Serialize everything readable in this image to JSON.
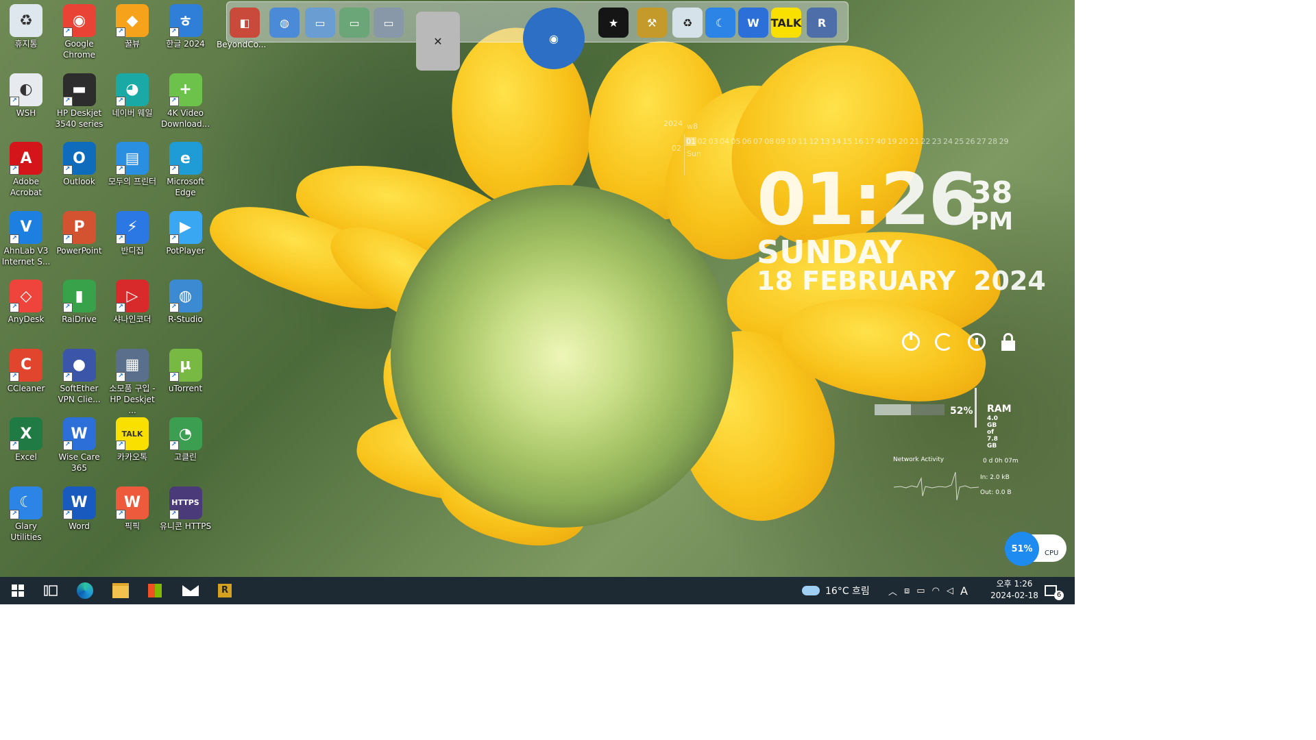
{
  "desktop": {
    "icons": [
      {
        "id": "recycle",
        "label": "휴지통",
        "color": "#dfe7ee",
        "glyph": "♻"
      },
      {
        "id": "chrome",
        "label": "Google Chrome",
        "color": "#e94335",
        "glyph": "◉"
      },
      {
        "id": "ggulbyu",
        "label": "꿀뷰",
        "color": "#f6a21a",
        "glyph": "◆"
      },
      {
        "id": "hangul",
        "label": "한글 2024",
        "color": "#2f7fd8",
        "glyph": "ㅎ"
      },
      {
        "id": "wsh",
        "label": "WSH",
        "color": "#e7eaee",
        "glyph": "◐"
      },
      {
        "id": "hp-deskjet",
        "label": "HP Deskjet 3540 series",
        "color": "#2d2d2d",
        "glyph": "▬"
      },
      {
        "id": "naver-whale",
        "label": "네이버 웨일",
        "color": "#1ba9a6",
        "glyph": "◕"
      },
      {
        "id": "4k-video",
        "label": "4K Video Download...",
        "color": "#6cc24a",
        "glyph": "+"
      },
      {
        "id": "acrobat",
        "label": "Adobe Acrobat",
        "color": "#d4161b",
        "glyph": "A"
      },
      {
        "id": "outlook",
        "label": "Outlook",
        "color": "#0f6cbd",
        "glyph": "O"
      },
      {
        "id": "modu-printer",
        "label": "모두의 프린터",
        "color": "#2a8fe0",
        "glyph": "▤"
      },
      {
        "id": "edge",
        "label": "Microsoft Edge",
        "color": "#1f9bd6",
        "glyph": "e"
      },
      {
        "id": "ahnlab",
        "label": "AhnLab V3 Internet S...",
        "color": "#1d7fe0",
        "glyph": "V"
      },
      {
        "id": "powerpoint",
        "label": "PowerPoint",
        "color": "#d35230",
        "glyph": "P"
      },
      {
        "id": "bandizip",
        "label": "반디집",
        "color": "#2b78e4",
        "glyph": "⚡"
      },
      {
        "id": "potplayer",
        "label": "PotPlayer",
        "color": "#3aa7f2",
        "glyph": "▶"
      },
      {
        "id": "anydesk",
        "label": "AnyDesk",
        "color": "#ef443b",
        "glyph": "◇"
      },
      {
        "id": "raidrive",
        "label": "RaiDrive",
        "color": "#37a24a",
        "glyph": "▮"
      },
      {
        "id": "shana",
        "label": "샤나인코더",
        "color": "#d82a2a",
        "glyph": "▷"
      },
      {
        "id": "rstudio",
        "label": "R-Studio",
        "color": "#3c8ad2",
        "glyph": "◍"
      },
      {
        "id": "ccleaner",
        "label": "CCleaner",
        "color": "#e2452e",
        "glyph": "C"
      },
      {
        "id": "softether",
        "label": "SoftEther VPN Clie...",
        "color": "#3b56a8",
        "glyph": "●"
      },
      {
        "id": "hp-purchase",
        "label": "소모품 구입 - HP Deskjet ...",
        "color": "#5a6f8c",
        "glyph": "▦"
      },
      {
        "id": "utorrent",
        "label": "uTorrent",
        "color": "#78b943",
        "glyph": "µ"
      },
      {
        "id": "excel",
        "label": "Excel",
        "color": "#1f7a43",
        "glyph": "X"
      },
      {
        "id": "wisecare",
        "label": "Wise Care 365",
        "color": "#2d6fd8",
        "glyph": "W"
      },
      {
        "id": "kakaotalk",
        "label": "카카오톡",
        "color": "#f9e000",
        "glyph": "TALK"
      },
      {
        "id": "goclean",
        "label": "고클린",
        "color": "#3b9e50",
        "glyph": "◔"
      },
      {
        "id": "glary",
        "label": "Glary Utilities",
        "color": "#2b84e6",
        "glyph": "☾"
      },
      {
        "id": "word",
        "label": "Word",
        "color": "#185abd",
        "glyph": "W"
      },
      {
        "id": "pikpik",
        "label": "픽픽",
        "color": "#ee5a3c",
        "glyph": "W"
      },
      {
        "id": "unicorn",
        "label": "유니콘 HTTPS",
        "color": "#4a3a7a",
        "glyph": "HTTPS"
      }
    ]
  },
  "dock": {
    "caption": "BeyondCo...",
    "items": [
      {
        "id": "beyondcompare",
        "color": "#c94a3a",
        "glyph": "◧"
      },
      {
        "id": "globe-tool",
        "color": "#4a8ad6",
        "glyph": "◍"
      },
      {
        "id": "folder-1",
        "color": "#6a9ed2",
        "glyph": "▭"
      },
      {
        "id": "folder-2",
        "color": "#6aa678",
        "glyph": "▭"
      },
      {
        "id": "folder-3",
        "color": "#8898a8",
        "glyph": "▭"
      },
      {
        "id": "tools",
        "color": "#b9b9b9",
        "glyph": "✕"
      },
      {
        "id": "earth",
        "color": "#2c6fc4",
        "glyph": "◉"
      },
      {
        "id": "tshirt",
        "color": "#151515",
        "glyph": "★"
      },
      {
        "id": "hammer",
        "color": "#c49a2a",
        "glyph": "⚒"
      },
      {
        "id": "recycle-dock",
        "color": "#d6e2ea",
        "glyph": "♻"
      },
      {
        "id": "glary-dock",
        "color": "#2b84e6",
        "glyph": "☾"
      },
      {
        "id": "wisecare-dock",
        "color": "#2d6fd8",
        "glyph": "W"
      },
      {
        "id": "kakaotalk-dock",
        "color": "#f9e000",
        "glyph": "TALK"
      },
      {
        "id": "rstudio-dock",
        "color": "#4d6ea8",
        "glyph": "R"
      }
    ]
  },
  "calendar": {
    "year": "2024",
    "week": "w8",
    "month": "02",
    "days": [
      "01",
      "02",
      "03",
      "04",
      "05",
      "06",
      "07",
      "08",
      "09",
      "10",
      "11",
      "12",
      "13",
      "14",
      "15",
      "16",
      "17",
      "40",
      "19",
      "20",
      "21",
      "22",
      "23",
      "24",
      "25",
      "26",
      "27",
      "28",
      "29"
    ],
    "dow": "Sun"
  },
  "clock": {
    "hm": "01:26",
    "seconds": "38",
    "ampm": "PM",
    "day": "SUNDAY",
    "date": "18 FEBRUARY",
    "year": "2024"
  },
  "ram": {
    "percent": "52%",
    "label": "RAM",
    "used": "4.0 GB",
    "total": "of 7.8 GB",
    "fill": 0.52
  },
  "network": {
    "title": "Network Activity",
    "uptime": "0 d 0h 07m",
    "in": "In: 2.0 kB",
    "out": "Out: 0.0 B"
  },
  "cpu": {
    "percent": "51%",
    "label": "CPU"
  },
  "taskbar": {
    "weather": "16°C  흐림",
    "ime": "A",
    "time": "오후 1:26",
    "date": "2024-02-18",
    "notifications": "6"
  }
}
